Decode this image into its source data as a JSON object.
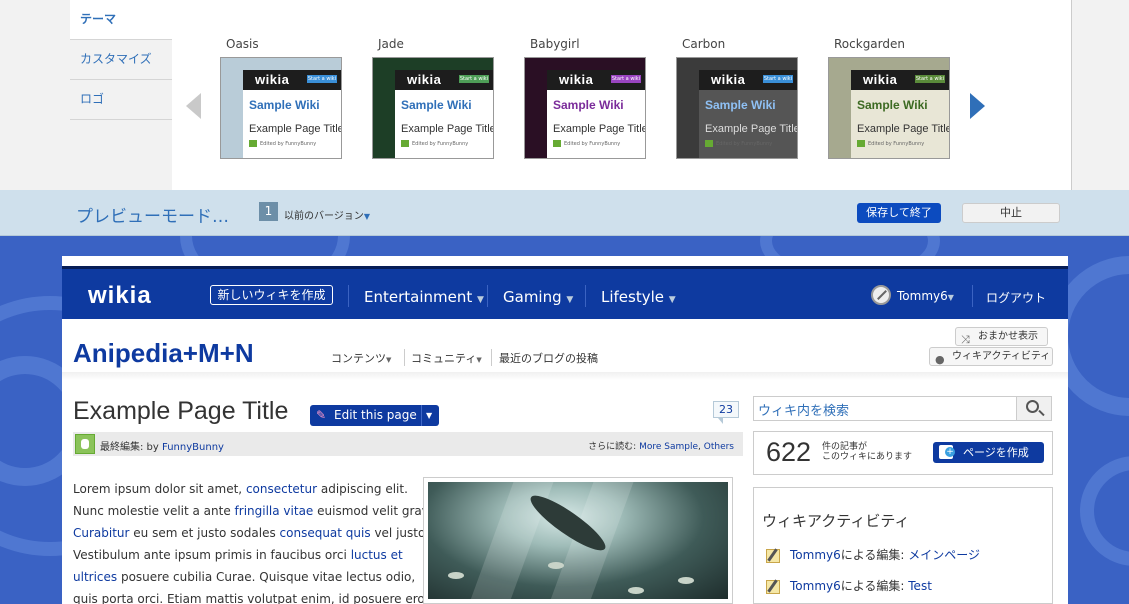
{
  "designer": {
    "tabs": [
      {
        "label": "テーマ",
        "active": true
      },
      {
        "label": "カスタマイズ",
        "active": false
      },
      {
        "label": "ロゴ",
        "active": false
      }
    ],
    "themes": [
      {
        "name": "Oasis",
        "bg": "#b9ccd8",
        "accent": "#3a8fd8"
      },
      {
        "name": "Jade",
        "bg": "#1d3e26",
        "accent": "#4e9e57"
      },
      {
        "name": "Babygirl",
        "bg": "#2a0f24",
        "accent": "#9945c0"
      },
      {
        "name": "Carbon",
        "bg": "#3b3b3b",
        "accent": "#3a8fd8"
      },
      {
        "name": "Rockgarden",
        "bg": "#a6a98f",
        "accent": "#5a8a3a"
      }
    ],
    "thumb": {
      "logo": "wikia",
      "start_button": "Start a wiki",
      "sample_wiki": "Sample Wiki",
      "example_title": "Example Page Title",
      "edited_by": "Edited by FunnyBunny"
    }
  },
  "preview_bar": {
    "mode_label": "プレビューモード…",
    "version_number": "1",
    "previous_versions": "以前のバージョン",
    "save_label": "保存して終了",
    "cancel_label": "中止"
  },
  "global_nav": {
    "logo": "wikia",
    "new_wiki": "新しいウィキを作成",
    "hubs": [
      "Entertainment",
      "Gaming",
      "Lifestyle"
    ],
    "username": "Tommy6",
    "logout": "ログアウト"
  },
  "wiki": {
    "name": "Anipedia+M+N",
    "local_nav": [
      "コンテンツ",
      "コミュニティ",
      "最近のブログの投稿"
    ],
    "random_page": "おまかせ表示",
    "wiki_activity": "ウィキアクティビティ"
  },
  "article": {
    "title": "Example Page Title",
    "edit_button": "Edit this page",
    "comment_count": "23",
    "last_edit_prefix": "最終編集: by",
    "last_editor": "FunnyBunny",
    "see_more_prefix": "さらに読む:",
    "see_more_1": "More Sample",
    "see_more_sep": ",",
    "see_more_2": "Others",
    "body": [
      [
        {
          "t": "Lorem ipsum dolor sit amet, "
        },
        {
          "t": "consectetur",
          "link": true
        },
        {
          "t": " adipiscing elit."
        }
      ],
      [
        {
          "t": "Nunc molestie velit a ante "
        },
        {
          "t": "fringilla vitae",
          "link": true
        },
        {
          "t": " euismod velit gravida."
        }
      ],
      [
        {
          "t": "Curabitur",
          "link": true
        },
        {
          "t": " eu sem et justo sodales "
        },
        {
          "t": "consequat quis",
          "link": true
        },
        {
          "t": " vel justo."
        }
      ],
      [
        {
          "t": "Vestibulum ante ipsum primis in faucibus orci "
        },
        {
          "t": "luctus et",
          "link": true
        }
      ],
      [
        {
          "t": "ultrices",
          "link": true
        },
        {
          "t": " posuere cubilia Curae. Quisque vitae lectus odio,"
        }
      ],
      [
        {
          "t": "quis porta orci. Etiam mattis volutpat enim, id posuere eros"
        }
      ]
    ]
  },
  "rail": {
    "search_placeholder": "ウィキ内を検索",
    "article_count": "622",
    "article_count_line1": "件の記事が",
    "article_count_line2": "このウィキにあります",
    "add_page": "ページを作成",
    "activity_title": "ウィキアクティビティ",
    "activity_items": [
      {
        "user": "Tommy6",
        "middle": "による編集:",
        "page": "メインページ"
      },
      {
        "user": "Tommy6",
        "middle": "による編集:",
        "page": "Test"
      }
    ]
  },
  "colors": {
    "wikia_blue": "#0e3aa0",
    "background_blue": "#3a62c4",
    "link_blue": "#2f6fb8",
    "preview_bar": "#cfe0ec"
  }
}
